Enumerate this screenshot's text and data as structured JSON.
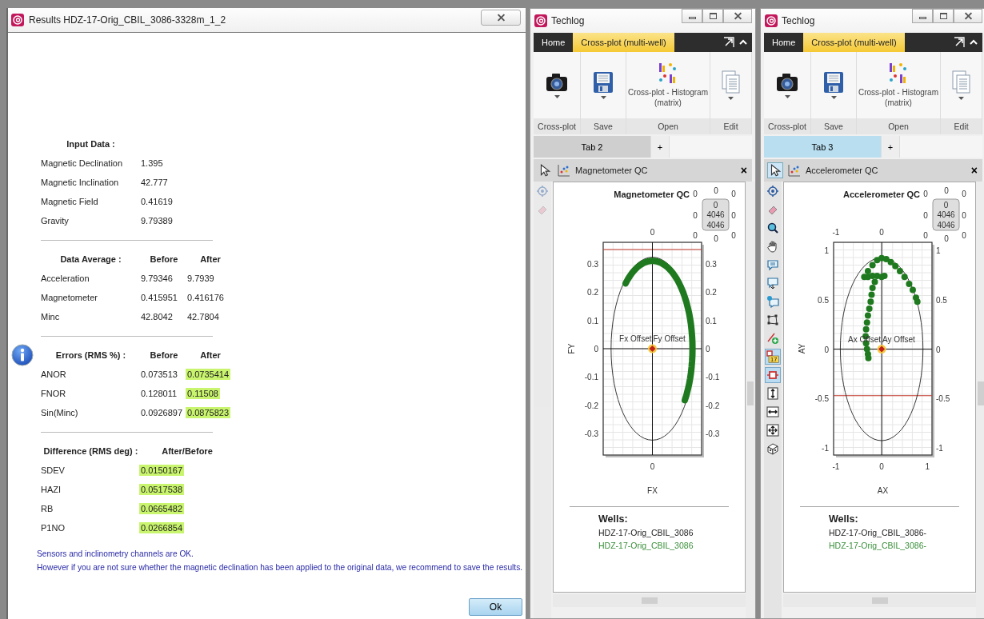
{
  "dialog": {
    "title": "Results HDZ-17-Orig_CBIL_3086-3328m_1_2",
    "sections": [
      {
        "heading": "Input Data :",
        "kind": "plain",
        "rows": [
          {
            "label": "Magnetic Declination",
            "values": [
              {
                "text": "1.395",
                "highlighted": false
              }
            ]
          },
          {
            "label": "Magnetic Inclination",
            "values": [
              {
                "text": "42.777",
                "highlighted": false
              }
            ]
          },
          {
            "label": "Magnetic Field",
            "values": [
              {
                "text": "0.41619",
                "highlighted": false
              }
            ]
          },
          {
            "label": "Gravity",
            "values": [
              {
                "text": "9.79389",
                "highlighted": false
              }
            ]
          }
        ]
      },
      {
        "heading": "Data Average :",
        "kind": "plain",
        "columns": [
          "Before",
          "After"
        ],
        "rows": [
          {
            "label": "Acceleration",
            "values": [
              {
                "text": "9.79346",
                "highlighted": false
              },
              {
                "text": "9.7939",
                "highlighted": false
              }
            ]
          },
          {
            "label": "Magnetometer",
            "values": [
              {
                "text": "0.415951",
                "highlighted": false
              },
              {
                "text": "0.416176",
                "highlighted": false
              }
            ]
          },
          {
            "label": "Minc",
            "values": [
              {
                "text": "42.8042",
                "highlighted": false
              },
              {
                "text": "42.7804",
                "highlighted": false
              }
            ]
          }
        ]
      },
      {
        "heading": "Errors (RMS %) :",
        "kind": "info",
        "columns": [
          "Before",
          "After"
        ],
        "rows": [
          {
            "label": "ANOR",
            "values": [
              {
                "text": "0.073513",
                "highlighted": false
              },
              {
                "text": "0.0735414",
                "highlighted": true
              }
            ]
          },
          {
            "label": "FNOR",
            "values": [
              {
                "text": "0.128011",
                "highlighted": false
              },
              {
                "text": "0.11508",
                "highlighted": true
              }
            ]
          },
          {
            "label": "Sin(Minc)",
            "values": [
              {
                "text": "0.0926897",
                "highlighted": false
              },
              {
                "text": "0.0875823",
                "highlighted": true
              }
            ]
          }
        ]
      },
      {
        "heading": "Difference (RMS deg) :",
        "kind": "plain",
        "columns": [
          "After/Before"
        ],
        "rows": [
          {
            "label": "SDEV",
            "values": [
              {
                "text": "0.0150167",
                "highlighted": true
              }
            ]
          },
          {
            "label": "HAZI",
            "values": [
              {
                "text": "0.0517538",
                "highlighted": true
              }
            ]
          },
          {
            "label": "RB",
            "values": [
              {
                "text": "0.0665482",
                "highlighted": true
              }
            ]
          },
          {
            "label": "P1NO",
            "values": [
              {
                "text": "0.0266854",
                "highlighted": true
              }
            ]
          }
        ]
      }
    ],
    "messages": [
      "Sensors and inclinometry channels are OK.",
      "However if you are not sure whether the magnetic declination has been applied to the original data, we recommend to save the results."
    ],
    "ok_button": "Ok"
  },
  "windows": [
    {
      "title": "Techlog",
      "active": false,
      "ribbon_tabs": [
        {
          "label": "Home",
          "selected": false
        },
        {
          "label": "Cross-plot (multi-well)",
          "selected": true
        }
      ],
      "ribbon_groups": [
        {
          "label": "Cross-plot",
          "kind": "camera",
          "dropdown": true
        },
        {
          "label": "Save",
          "kind": "floppy",
          "dropdown": true
        },
        {
          "label": "Open",
          "kind": "matrix",
          "caption": "Cross-plot - Histogram (matrix)",
          "dropdown": false
        },
        {
          "label": "Edit",
          "kind": "pages",
          "dropdown": true
        }
      ],
      "doc_tabs": [
        {
          "label": "Tab 2",
          "selected": true
        }
      ],
      "add_tab": "+",
      "panel": {
        "title": "Magnetometer QC",
        "pointer_selected": false,
        "close": "×",
        "tools": [
          {
            "kind": "target",
            "selected": false
          },
          {
            "kind": "eraser",
            "selected": false
          }
        ],
        "chart": {
          "title": "Magnetometer QC",
          "outer_values": [
            "0",
            "0",
            "0",
            "0",
            "0",
            "0",
            "0",
            "0"
          ],
          "box_values": [
            "0",
            "4046",
            "4046"
          ],
          "top_axis_ticks": [
            "0"
          ],
          "bottom_axis_ticks": [
            "0"
          ],
          "left_axis_ticks": [
            "0.3",
            "0.2",
            "0.1",
            "0",
            "-0.1",
            "-0.2",
            "-0.3"
          ],
          "right_axis_ticks": [
            "0.3",
            "0.2",
            "0.1",
            "0",
            "-0.1",
            "-0.2",
            "-0.3"
          ],
          "xlabel": "FX",
          "ylabel": "FY",
          "offset_labels": [
            "Fx Offset",
            "Fy Offset"
          ]
        },
        "wells_heading": "Wells:",
        "wells": [
          {
            "name": "HDZ-17-Orig_CBIL_3086",
            "color": "#222222"
          },
          {
            "name": "HDZ-17-Orig_CBIL_3086",
            "color": "#3a8e3a"
          }
        ]
      }
    },
    {
      "title": "Techlog",
      "active": true,
      "ribbon_tabs": [
        {
          "label": "Home",
          "selected": false
        },
        {
          "label": "Cross-plot (multi-well)",
          "selected": true
        }
      ],
      "ribbon_groups": [
        {
          "label": "Cross-plot",
          "kind": "camera",
          "dropdown": true
        },
        {
          "label": "Save",
          "kind": "floppy",
          "dropdown": true
        },
        {
          "label": "Open",
          "kind": "matrix",
          "caption": "Cross-plot - Histogram (matrix)",
          "dropdown": false
        },
        {
          "label": "Edit",
          "kind": "pages",
          "dropdown": true
        }
      ],
      "doc_tabs": [
        {
          "label": "Tab 3",
          "selected": true
        }
      ],
      "add_tab": "+",
      "panel": {
        "title": "Accelerometer QC",
        "pointer_selected": true,
        "close": "×",
        "tools": [
          {
            "kind": "target",
            "selected": false
          },
          {
            "kind": "eraser",
            "selected": false
          },
          {
            "kind": "zoom",
            "selected": false
          },
          {
            "kind": "hand",
            "selected": false
          },
          {
            "kind": "comment",
            "selected": false
          },
          {
            "kind": "comment-down",
            "selected": false
          },
          {
            "kind": "comment-pin",
            "selected": false
          },
          {
            "kind": "polygon",
            "selected": false
          },
          {
            "kind": "line-add",
            "selected": false
          },
          {
            "kind": "label",
            "text": "17",
            "selected": true
          },
          {
            "kind": "node",
            "selected": true
          },
          {
            "kind": "fit-vertical",
            "selected": false
          },
          {
            "kind": "fit-horizontal",
            "selected": false
          },
          {
            "kind": "fit-all",
            "selected": false
          },
          {
            "kind": "dice",
            "selected": false
          }
        ],
        "chart": {
          "title": "Accelerometer QC",
          "outer_values": [
            "0",
            "0",
            "0",
            "0",
            "0",
            "0",
            "0",
            "0"
          ],
          "box_values": [
            "0",
            "4046",
            "4046"
          ],
          "bottom_axis_ticks": [
            "-1",
            "0",
            "1"
          ],
          "left_axis_ticks": [
            "1",
            "0.5",
            "0",
            "-0.5",
            "-1"
          ],
          "chart_data": {
            "type": "scatter",
            "xlabel": "AX",
            "ylabel": "AY",
            "grid": true,
            "xlim": [
              -1.05,
              1.1
            ],
            "ylim": [
              -1.07,
              1.08
            ],
            "xticks": [
              -1,
              0
            ],
            "yticks": [
              -1,
              -0.5,
              0,
              0.5,
              1
            ],
            "x": [
              0,
              0.1,
              0.2,
              0.3,
              0.4,
              0.5,
              0.6,
              0.68,
              0.75,
              0.78,
              -0.1,
              -0.2,
              -0.3,
              -0.38,
              -0.3,
              -0.2,
              -0.1,
              0,
              0.06,
              -0.15,
              -0.2,
              -0.22,
              -0.24,
              -0.27,
              -0.3,
              -0.32,
              -0.34,
              -0.35,
              -0.34,
              -0.32,
              -0.3,
              -0.29
            ],
            "series": [
              {
                "color": "#1f7a1f",
                "values": [
                  0.92,
                  0.91,
                  0.88,
                  0.84,
                  0.79,
                  0.73,
                  0.66,
                  0.6,
                  0.52,
                  0.48,
                  0.9,
                  0.85,
                  0.79,
                  0.73,
                  0.73,
                  0.74,
                  0.74,
                  0.73,
                  0.74,
                  0.68,
                  0.62,
                  0.55,
                  0.48,
                  0.41,
                  0.34,
                  0.27,
                  0.2,
                  0.13,
                  0.06,
                  0,
                  -0.05,
                  -0.09
                ]
              }
            ],
            "ref_lines": [
              {
                "axis": "y",
                "value": -0.47,
                "color": "#c0392b"
              }
            ],
            "annotations": [
              {
                "text": "Ax Offset"
              },
              {
                "text": "Ay Offset"
              }
            ]
          }
        },
        "wells_heading": "Wells:",
        "wells": [
          {
            "name": "HDZ-17-Orig_CBIL_3086-",
            "color": "#222222"
          },
          {
            "name": "HDZ-17-Orig_CBIL_3086-",
            "color": "#3a8e3a"
          }
        ]
      }
    }
  ]
}
